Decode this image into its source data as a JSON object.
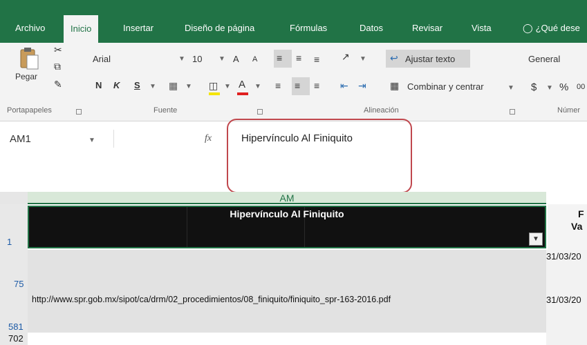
{
  "ribbon_tabs": {
    "archivo": "Archivo",
    "inicio": "Inicio",
    "insertar": "Insertar",
    "diseno": "Diseño de página",
    "formulas": "Fórmulas",
    "datos": "Datos",
    "revisar": "Revisar",
    "vista": "Vista",
    "tell_me": "¿Qué dese"
  },
  "clipboard": {
    "paste_label": "Pegar",
    "group_label": "Portapapeles"
  },
  "font": {
    "font_name": "Arial",
    "font_size": "10",
    "grow_label": "A",
    "shrink_label": "A",
    "bold_label": "N",
    "italic_label": "K",
    "underline_label": "S",
    "font_color_label": "A",
    "group_label": "Fuente"
  },
  "alignment": {
    "wrap_text_label": "Ajustar texto",
    "merge_center_label": "Combinar y centrar",
    "group_label": "Alineación"
  },
  "number": {
    "format_value": "General",
    "currency_label": "$",
    "percent_label": "%",
    "comma_label": "00",
    "group_label": "Númer"
  },
  "formula_bar": {
    "name_box": "AM1",
    "fx_label": "fx",
    "content": "Hipervínculo Al Finiquito"
  },
  "grid": {
    "column_letter": "AM",
    "header_text": "Hipervínculo Al Finiquito",
    "next_col_header_line1": "F",
    "next_col_header_line2": "Va",
    "rows": [
      {
        "number": "1"
      },
      {
        "number": "75"
      },
      {
        "number": "581"
      },
      {
        "number": "702"
      }
    ],
    "url_cell": "http://www.spr.gob.mx/sipot/ca/drm/02_procedimientos/08_finiquito/finiquito_spr-163-2016.pdf",
    "dates": [
      "31/03/20",
      "31/03/20"
    ]
  },
  "colors": {
    "ribbon_green": "#217346",
    "callout_red": "#c0474d",
    "header_fill": "#111111",
    "row_number_blue": "#1c5aa6"
  }
}
